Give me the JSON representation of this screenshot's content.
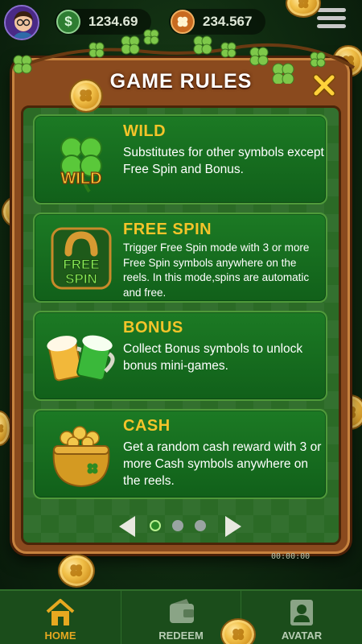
{
  "header": {
    "cash_balance": "1234.69",
    "cash_icon": "dollar-coin-icon",
    "coin_balance": "234.567",
    "coin_icon": "clover-coin-icon"
  },
  "modal": {
    "title": "GAME RULES",
    "rules": [
      {
        "title": "WILD",
        "icon": "wild-clover-icon",
        "description": "Substitutes for other symbols except Free Spin and Bonus."
      },
      {
        "title": "FREE SPIN",
        "icon": "free-spin-horseshoe-icon",
        "description": "Trigger Free Spin mode with 3 or more Free Spin symbols anywhere on the reels. In this mode,spins are automatic and free."
      },
      {
        "title": "BONUS",
        "icon": "beer-mugs-icon",
        "description": "Collect Bonus symbols to unlock bonus mini-games."
      },
      {
        "title": "CASH",
        "icon": "pot-of-gold-icon",
        "description": "Get a random cash reward with 3 or more Cash symbols anywhere on the reels."
      }
    ],
    "icon_texts": {
      "wild": "WILD",
      "free": "FREE",
      "spin": "SPIN"
    },
    "pager": {
      "pages": 3,
      "current": 1
    }
  },
  "timer": "00:00:00",
  "bottom_nav": [
    {
      "label": "HOME",
      "icon": "home-icon",
      "active": true
    },
    {
      "label": "REDEEM",
      "icon": "wallet-icon",
      "active": false
    },
    {
      "label": "AVATAR",
      "icon": "avatar-icon",
      "active": false
    }
  ],
  "colors": {
    "accent": "#f4c42a",
    "card_green": "#1c7a24",
    "frame_brown": "#8a4a1e",
    "active_nav": "#e6a820"
  }
}
